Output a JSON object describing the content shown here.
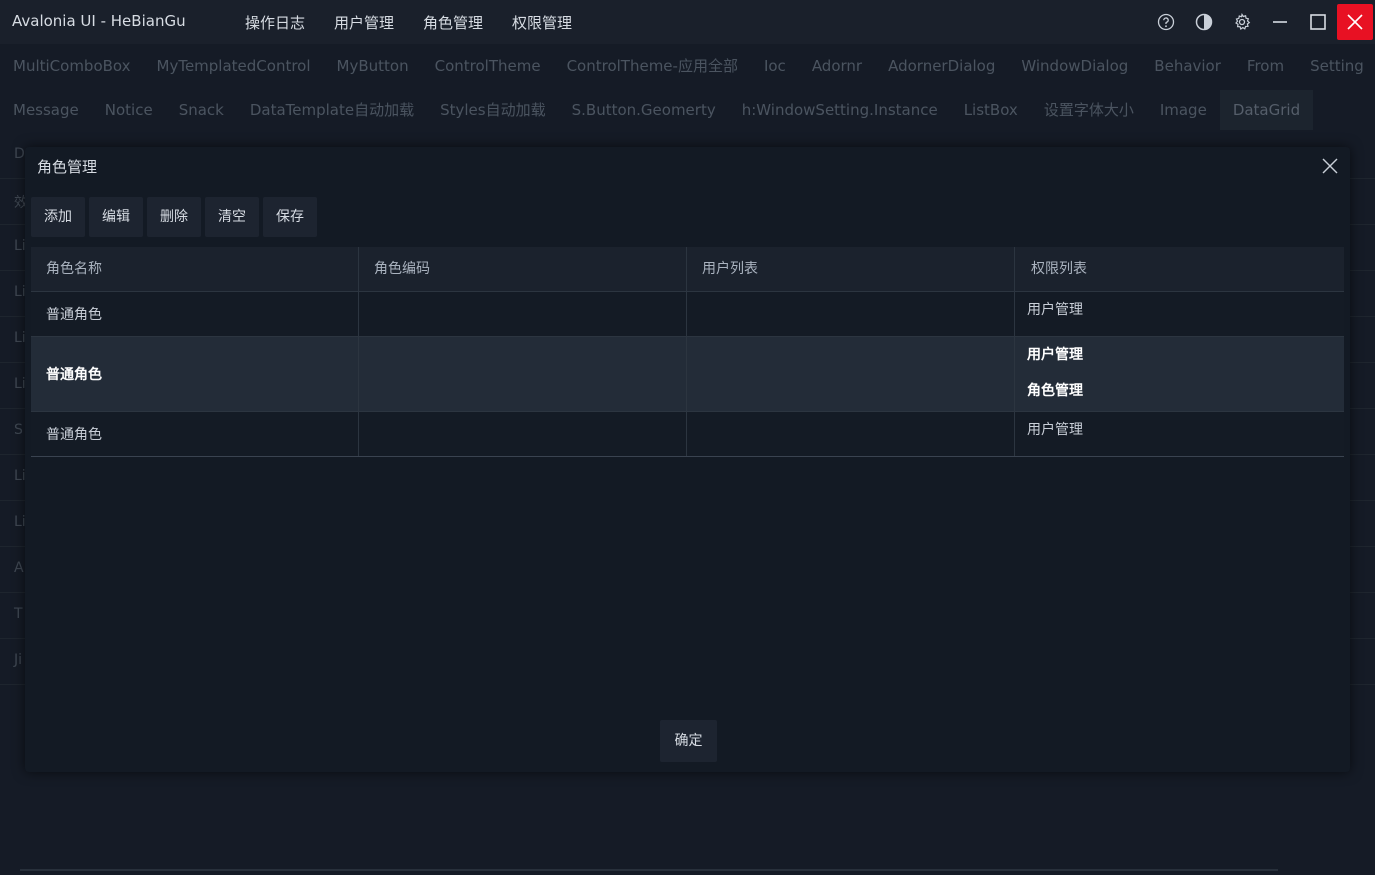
{
  "app": {
    "title": "Avalonia UI - HeBianGu",
    "menu": [
      "操作日志",
      "用户管理",
      "角色管理",
      "权限管理"
    ],
    "controls": {
      "help_icon": "help-circle-icon",
      "theme_icon": "half-circle-icon",
      "settings_icon": "gear-icon",
      "minimize_icon": "minimize-icon",
      "maximize_icon": "maximize-icon",
      "close_icon": "close-icon",
      "close_color": "#e81123"
    }
  },
  "tabs_row1": [
    "MultiComboBox",
    "MyTemplatedControl",
    "MyButton",
    "ControlTheme",
    "ControlTheme-应用全部",
    "Ioc",
    "Adornr",
    "AdornerDialog",
    "WindowDialog",
    "Behavior",
    "From",
    "Setting"
  ],
  "tabs_row2": [
    "Message",
    "Notice",
    "Snack",
    "DataTemplate自动加载",
    "Styles自动加载",
    "S.Button.Geomerty",
    "h:WindowSetting.Instance",
    "ListBox",
    "设置字体大小",
    "Image",
    "DataGrid"
  ],
  "tabs_row2_active": "DataGrid",
  "background_list_letters": [
    "D",
    "效",
    "Li",
    "Li",
    "Li",
    "Li",
    "S",
    "Li",
    "Li",
    "A",
    "T",
    "Ji"
  ],
  "dialog": {
    "title": "角色管理",
    "toolbar": [
      "添加",
      "编辑",
      "删除",
      "清空",
      "保存"
    ],
    "columns": [
      "角色名称",
      "角色编码",
      "用户列表",
      "权限列表"
    ],
    "rows": [
      {
        "name": "普通角色",
        "code": "",
        "users": "",
        "permissions": [
          "用户管理"
        ],
        "selected": false
      },
      {
        "name": "普通角色",
        "code": "",
        "users": "",
        "permissions": [
          "用户管理",
          "角色管理"
        ],
        "selected": true
      },
      {
        "name": "普通角色",
        "code": "",
        "users": "",
        "permissions": [
          "用户管理"
        ],
        "selected": false
      }
    ],
    "ok_label": "确定"
  }
}
